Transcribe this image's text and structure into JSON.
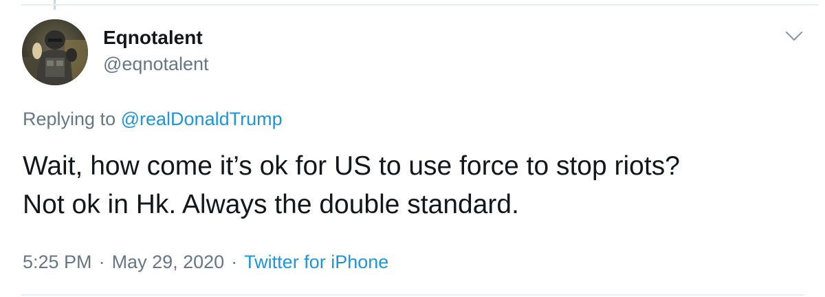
{
  "tweet": {
    "author": {
      "display_name": "Eqnotalent",
      "handle": "@eqnotalent",
      "avatar_icon": "armored-figure-avatar"
    },
    "reply_context": {
      "prefix": "Replying to",
      "mention": "@realDonaldTrump"
    },
    "text_lines": [
      "Wait, how come it’s ok for US to use force to stop riots?",
      "Not ok in Hk. Always the double standard."
    ],
    "meta": {
      "time": "5:25 PM",
      "separator": "·",
      "date": "May 29, 2020",
      "source": "Twitter for iPhone"
    },
    "menu_icon": "chevron-down-icon"
  },
  "colors": {
    "text_primary": "#14171a",
    "text_secondary": "#657786",
    "link": "#1b95e0",
    "border": "#e6ecf0"
  }
}
